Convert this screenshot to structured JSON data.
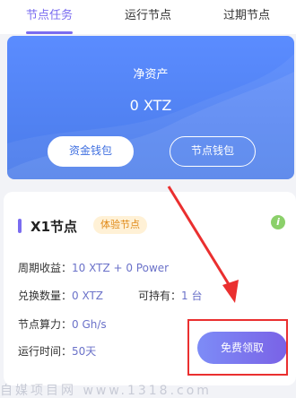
{
  "tabs": [
    {
      "label": "节点任务",
      "active": true
    },
    {
      "label": "运行节点",
      "active": false
    },
    {
      "label": "过期节点",
      "active": false
    }
  ],
  "assets": {
    "label": "净资产",
    "value": "0 XTZ",
    "fund_wallet": "资金钱包",
    "node_wallet": "节点钱包"
  },
  "node": {
    "title": "X1节点",
    "tag": "体验节点",
    "info_icon": "i",
    "cycle_income_label": "周期收益：",
    "cycle_income_value": "10 XTZ + 0 Power",
    "exchange_label": "兑换数量：",
    "exchange_value": "0 XTZ",
    "holdable_label": "可持有：",
    "holdable_value": "1 台",
    "hashrate_label": "节点算力：",
    "hashrate_value": "0 Gh/s",
    "runtime_label": "运行时间：",
    "runtime_value": "50天",
    "claim_button": "免费领取"
  },
  "watermark": "自媒项目网 www.1318.com",
  "colors": {
    "accent": "#7a6cf0",
    "card_blue": "#4a7be9",
    "annotation_red": "#ea2f2f"
  }
}
